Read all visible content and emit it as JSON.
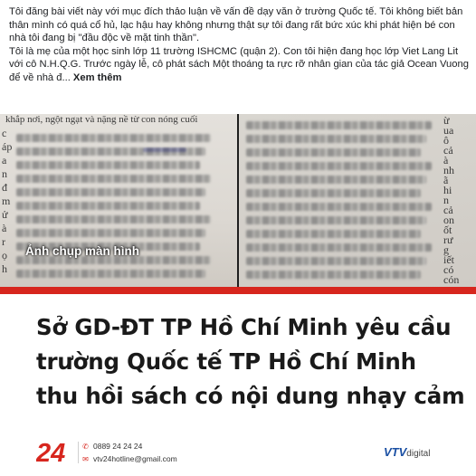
{
  "post": {
    "paragraph1": "Tôi đăng bài viết này với mục đích thảo luận về vấn đề dạy văn ở trường Quốc tế. Tôi không biết bản thân mình có quá cổ hủ, lạc hậu hay không nhưng thật sự tôi đang rất bức xúc khi phát hiện bé con nhà tôi đang bị \"đầu độc về mặt tinh thần\".",
    "paragraph2": "Tôi là mẹ của một học sinh lớp 11 trường ISHCMC (quận 2). Con tôi hiện đang học lớp Viet Lang Lit với cô N.H.Q.G. Trước ngày lễ, cô phát sách Một thoáng ta rực rỡ nhân gian của tác giả Ocean Vuong để về nhà đ...",
    "see_more": "Xem thêm"
  },
  "photo": {
    "caption": "Ảnh chụp màn hình",
    "left_top_text": "khắp nơi, ngột ngạt và nặng nề từ con nóng cuối",
    "right_edge_fragments": [
      "ừ",
      "ua",
      "ô",
      "cả",
      "à",
      "nh",
      "ã",
      "hi",
      "n",
      "cả",
      "on",
      "ốt",
      "rư",
      "g",
      "iết",
      "có",
      "cón"
    ],
    "left_edge_fragments": [
      "c",
      "áp",
      "a",
      "n",
      "đ",
      "m",
      "ử",
      "à",
      "r",
      "ọ",
      "h"
    ]
  },
  "headline": {
    "line1": "Sở GD-ĐT TP Hồ Chí Minh yêu cầu",
    "line2": "trường Quốc tế TP Hồ Chí Minh",
    "line3": "thu hồi sách có nội dung nhạy cảm"
  },
  "footer": {
    "logo_text": "24",
    "phone": "0889 24 24 24",
    "email": "vtv24hotline@gmail.com",
    "brand_v": "VTV",
    "brand_digital": "digital"
  },
  "colors": {
    "accent_red": "#d7261e",
    "brand_blue": "#1a4fa3"
  }
}
